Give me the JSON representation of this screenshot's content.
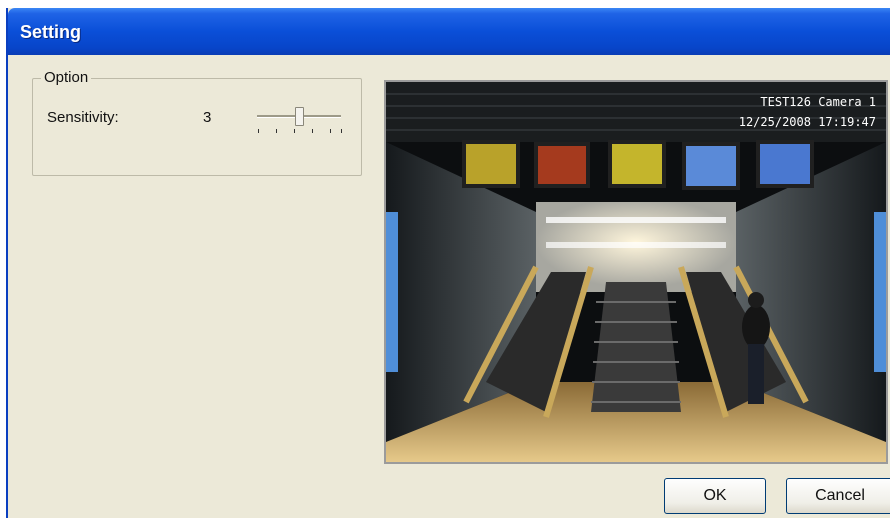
{
  "window": {
    "title": "Setting"
  },
  "option": {
    "legend": "Option",
    "sensitivity_label": "Sensitivity:",
    "sensitivity_value": "3"
  },
  "preview": {
    "overlay_line1": "TEST126  Camera 1",
    "overlay_line2": "12/25/2008 17:19:47"
  },
  "buttons": {
    "ok": "OK",
    "cancel": "Cancel"
  },
  "colors": {
    "title_bar": "#0a4fd8",
    "dialog_bg": "#ece9d8"
  }
}
